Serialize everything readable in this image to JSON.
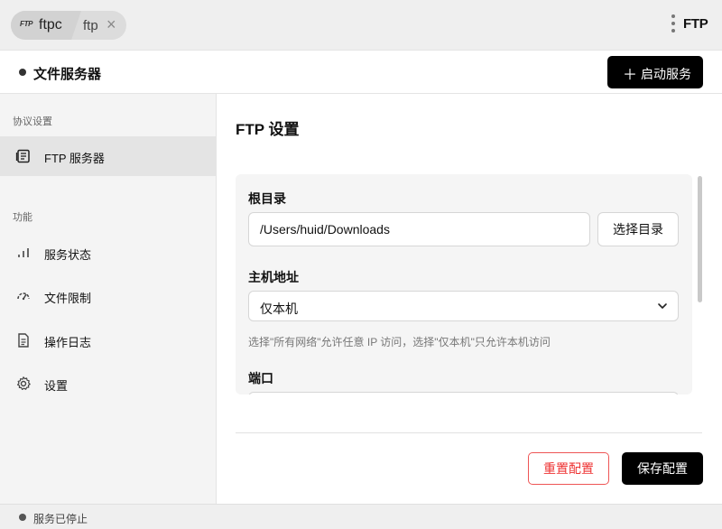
{
  "titlebar": {
    "tab_logo": "FTP",
    "active_tab": "ftpc",
    "second_tab": "ftp",
    "close_glyph": "×",
    "menu_icon": "kebab-menu-icon",
    "brand": "FTP"
  },
  "header": {
    "title": "文件服务器",
    "start_button": "启动服务",
    "start_icon": "＋"
  },
  "sidebar": {
    "protocol_section": "协议设置",
    "protocol_items": [
      {
        "label": "FTP 服务器",
        "icon": "server-doc-icon",
        "active": true
      }
    ],
    "features_section": "功能",
    "feature_items": [
      {
        "label": "服务状态",
        "icon": "bar-chart-icon"
      },
      {
        "label": "文件限制",
        "icon": "gauge-icon"
      },
      {
        "label": "操作日志",
        "icon": "document-icon"
      },
      {
        "label": "设置",
        "icon": "gear-icon"
      }
    ]
  },
  "main": {
    "title": "FTP 设置",
    "root_dir_label": "根目录",
    "root_dir_value": "/Users/huid/Downloads",
    "choose_dir_button": "选择目录",
    "host_label": "主机地址",
    "host_value": "仅本机",
    "host_hint": "选择\"所有网络\"允许任意 IP 访问，选择\"仅本机\"只允许本机访问",
    "port_label": "端口",
    "reset_button": "重置配置",
    "save_button": "保存配置"
  },
  "status": {
    "text": "服务已停止"
  },
  "colors": {
    "primary_button": "#000000",
    "danger": "#e33333",
    "sidebar_bg": "#f4f4f4",
    "active_item_bg": "#e4e4e4"
  }
}
